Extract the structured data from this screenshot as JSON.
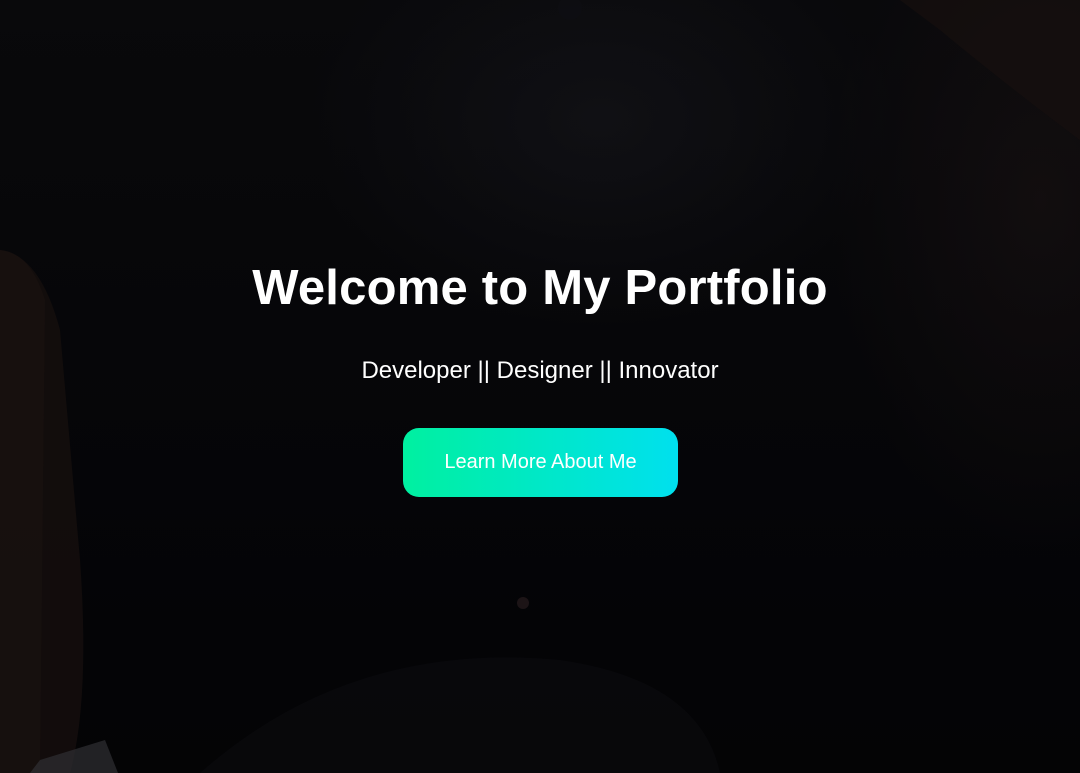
{
  "hero": {
    "title": "Welcome to My Portfolio",
    "subtitle": "Developer || Designer || Innovator",
    "cta_label": "Learn More About Me"
  },
  "colors": {
    "background": "#07070a",
    "text": "#ffffff",
    "cta_gradient_start": "#00f0a0",
    "cta_gradient_end": "#00e0ee"
  }
}
